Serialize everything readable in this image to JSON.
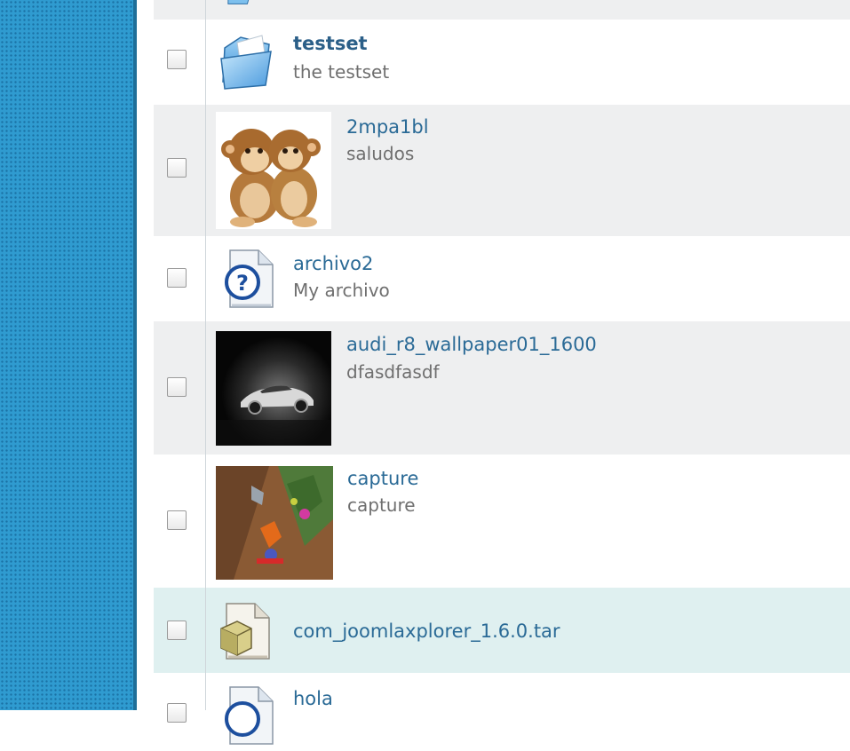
{
  "items": [
    {
      "title": "",
      "desc": "",
      "icon": "folder-icon"
    },
    {
      "title": "testset",
      "desc": "the testset",
      "icon": "folder-icon"
    },
    {
      "title": "2mpa1bl",
      "desc": "saludos",
      "icon": "monkeys-thumbnail"
    },
    {
      "title": "archivo2",
      "desc": "My archivo",
      "icon": "unknown-file-icon"
    },
    {
      "title": "audi_r8_wallpaper01_1600",
      "desc": "dfasdfasdf",
      "icon": "car-thumbnail"
    },
    {
      "title": "capture",
      "desc": "capture",
      "icon": "game-capture-thumbnail"
    },
    {
      "title": "com_joomlaxplorer_1.6.0.tar",
      "desc": "",
      "icon": "archive-file-icon"
    },
    {
      "title": "hola",
      "desc": "",
      "icon": "unknown-file-icon"
    }
  ],
  "colors": {
    "sidebar": "#2f9bd0",
    "row_alt": "#eeeff0",
    "row_selected": "#dff0f0",
    "link": "#2a6a96"
  }
}
